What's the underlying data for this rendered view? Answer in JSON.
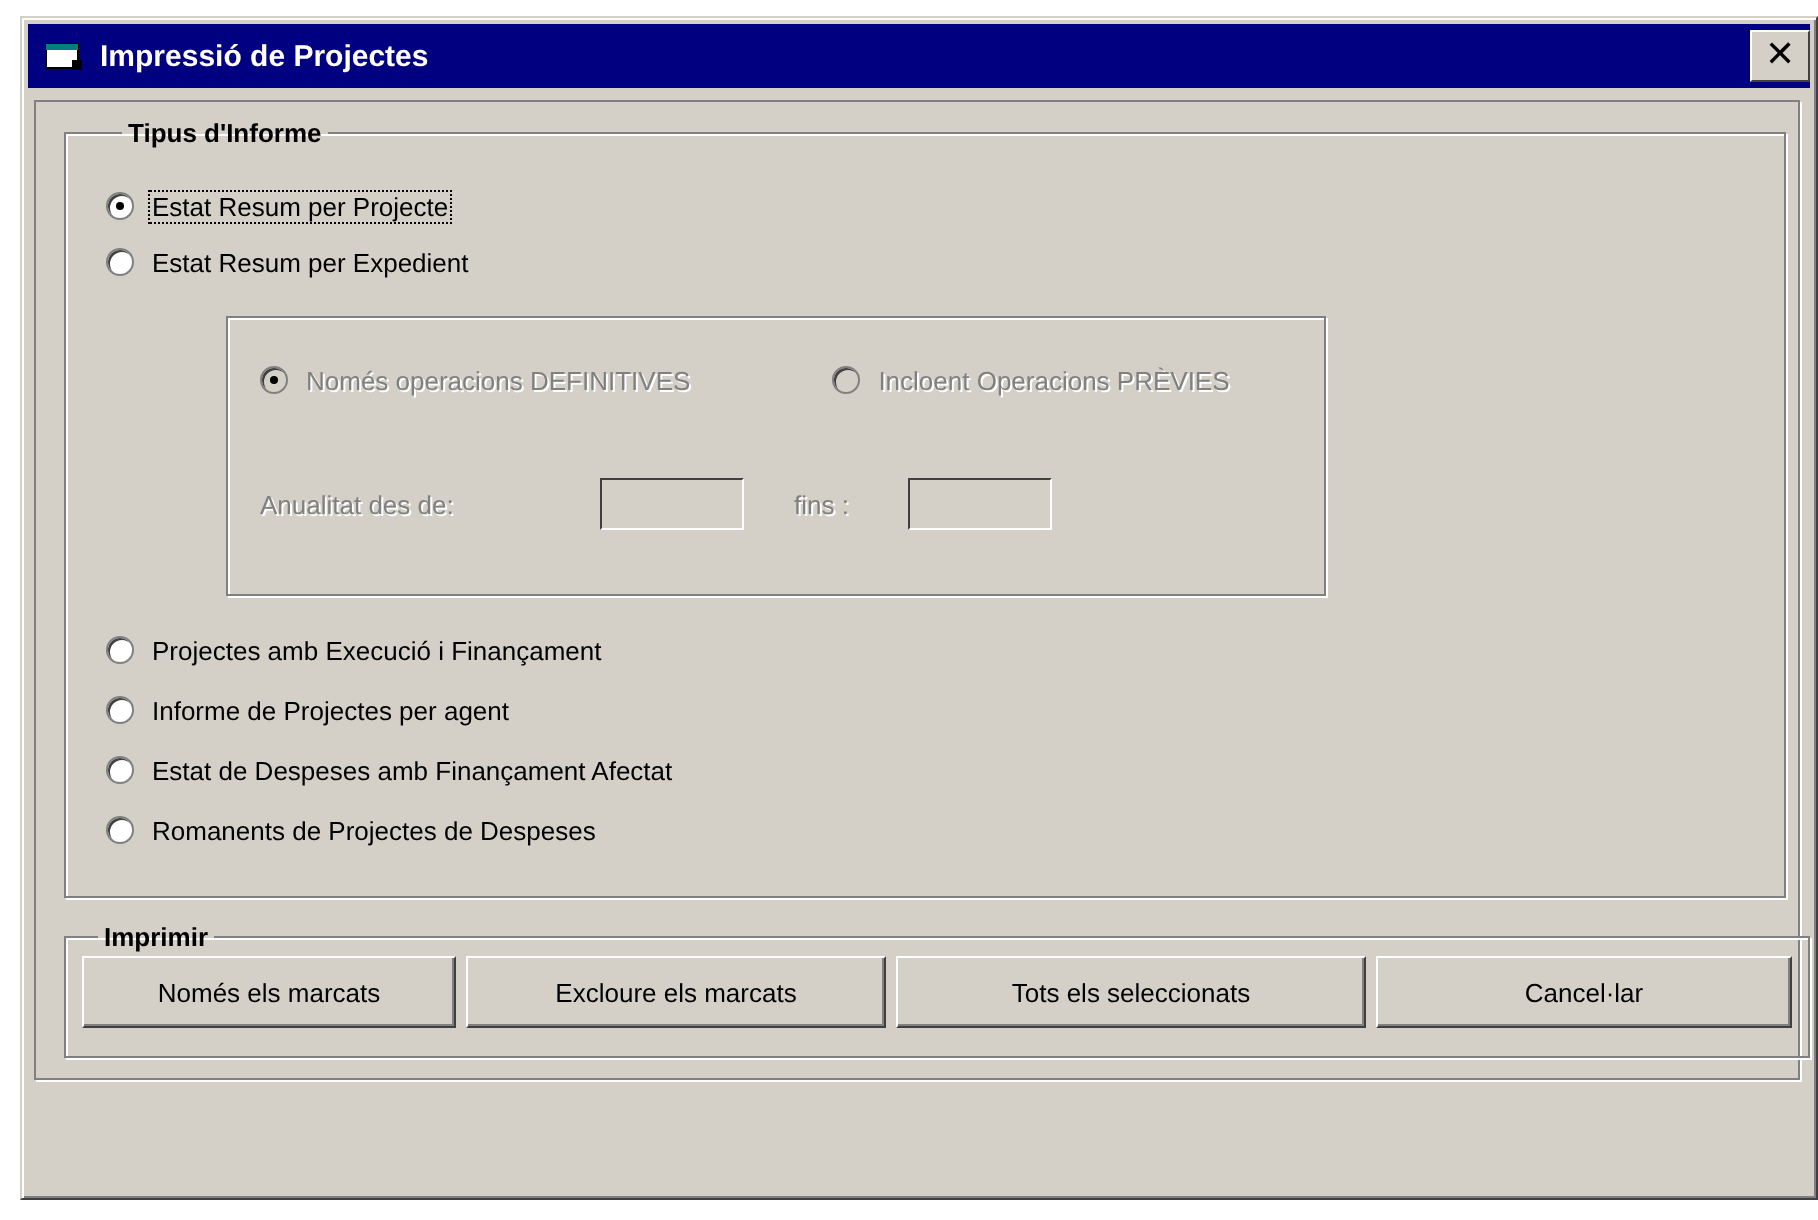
{
  "window": {
    "title": "Impressió de Projectes",
    "close": "✕"
  },
  "report_type": {
    "label": "Tipus d'Informe",
    "options_top": [
      {
        "label": "Estat Resum per Projecte",
        "selected": true,
        "focused": true
      },
      {
        "label": "Estat Resum per Expedient",
        "selected": false,
        "focused": false
      }
    ],
    "sub_panel": {
      "disabled": true,
      "options": [
        {
          "label": "Només operacions DEFINITIVES",
          "selected": true
        },
        {
          "label": "Incloent Operacions PRÈVIES",
          "selected": false
        }
      ],
      "from_label": "Anualitat des de:",
      "to_label": "fins :"
    },
    "options_bottom": [
      {
        "label": "Projectes amb Execució i Finançament",
        "selected": false
      },
      {
        "label": "Informe de Projectes per agent",
        "selected": false
      },
      {
        "label": "Estat de Despeses amb Finançament Afectat",
        "selected": false
      },
      {
        "label": "Romanents de Projectes de Despeses",
        "selected": false
      }
    ]
  },
  "print": {
    "label": "Imprimir",
    "buttons": [
      "Només els marcats",
      "Excloure els marcats",
      "Tots els seleccionats",
      "Cancel·lar"
    ]
  }
}
